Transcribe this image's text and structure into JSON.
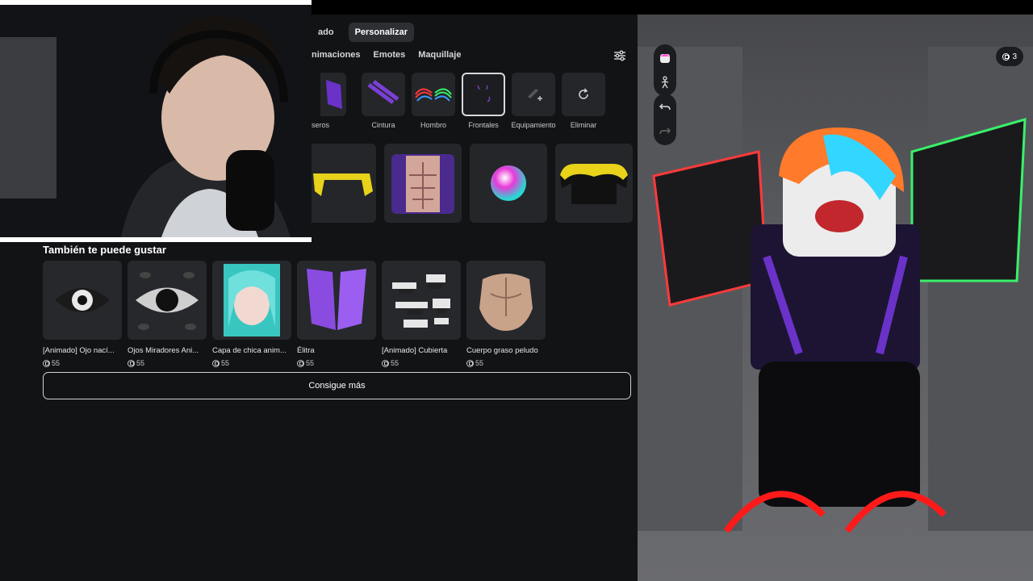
{
  "top_tabs": [
    "ado",
    "Personalizar"
  ],
  "sub_tabs": [
    "nimaciones",
    "Emotes",
    "Maquillaje"
  ],
  "categories": [
    {
      "label": "seros"
    },
    {
      "label": "Cintura"
    },
    {
      "label": "Hombro"
    },
    {
      "label": "Frontales"
    },
    {
      "label": "Equipamiento"
    },
    {
      "label": "Eliminar"
    }
  ],
  "section_title": "También te puede gustar",
  "recommendations": [
    {
      "name": "[Animado] Ojo nací...",
      "price": "55"
    },
    {
      "name": "Ojos Miradores Ani...",
      "price": "55"
    },
    {
      "name": "Capa de chica anim...",
      "price": "55"
    },
    {
      "name": "Élitra",
      "price": "55"
    },
    {
      "name": "[Animado] Cubierta",
      "price": "55"
    },
    {
      "name": "Cuerpo graso peludo",
      "price": "55"
    }
  ],
  "more_button": "Consigue más",
  "viewport": {
    "count": "3"
  },
  "colors": {
    "background": "#121315",
    "tile": "#24262a",
    "accent_purple": "#7b3fd6"
  }
}
